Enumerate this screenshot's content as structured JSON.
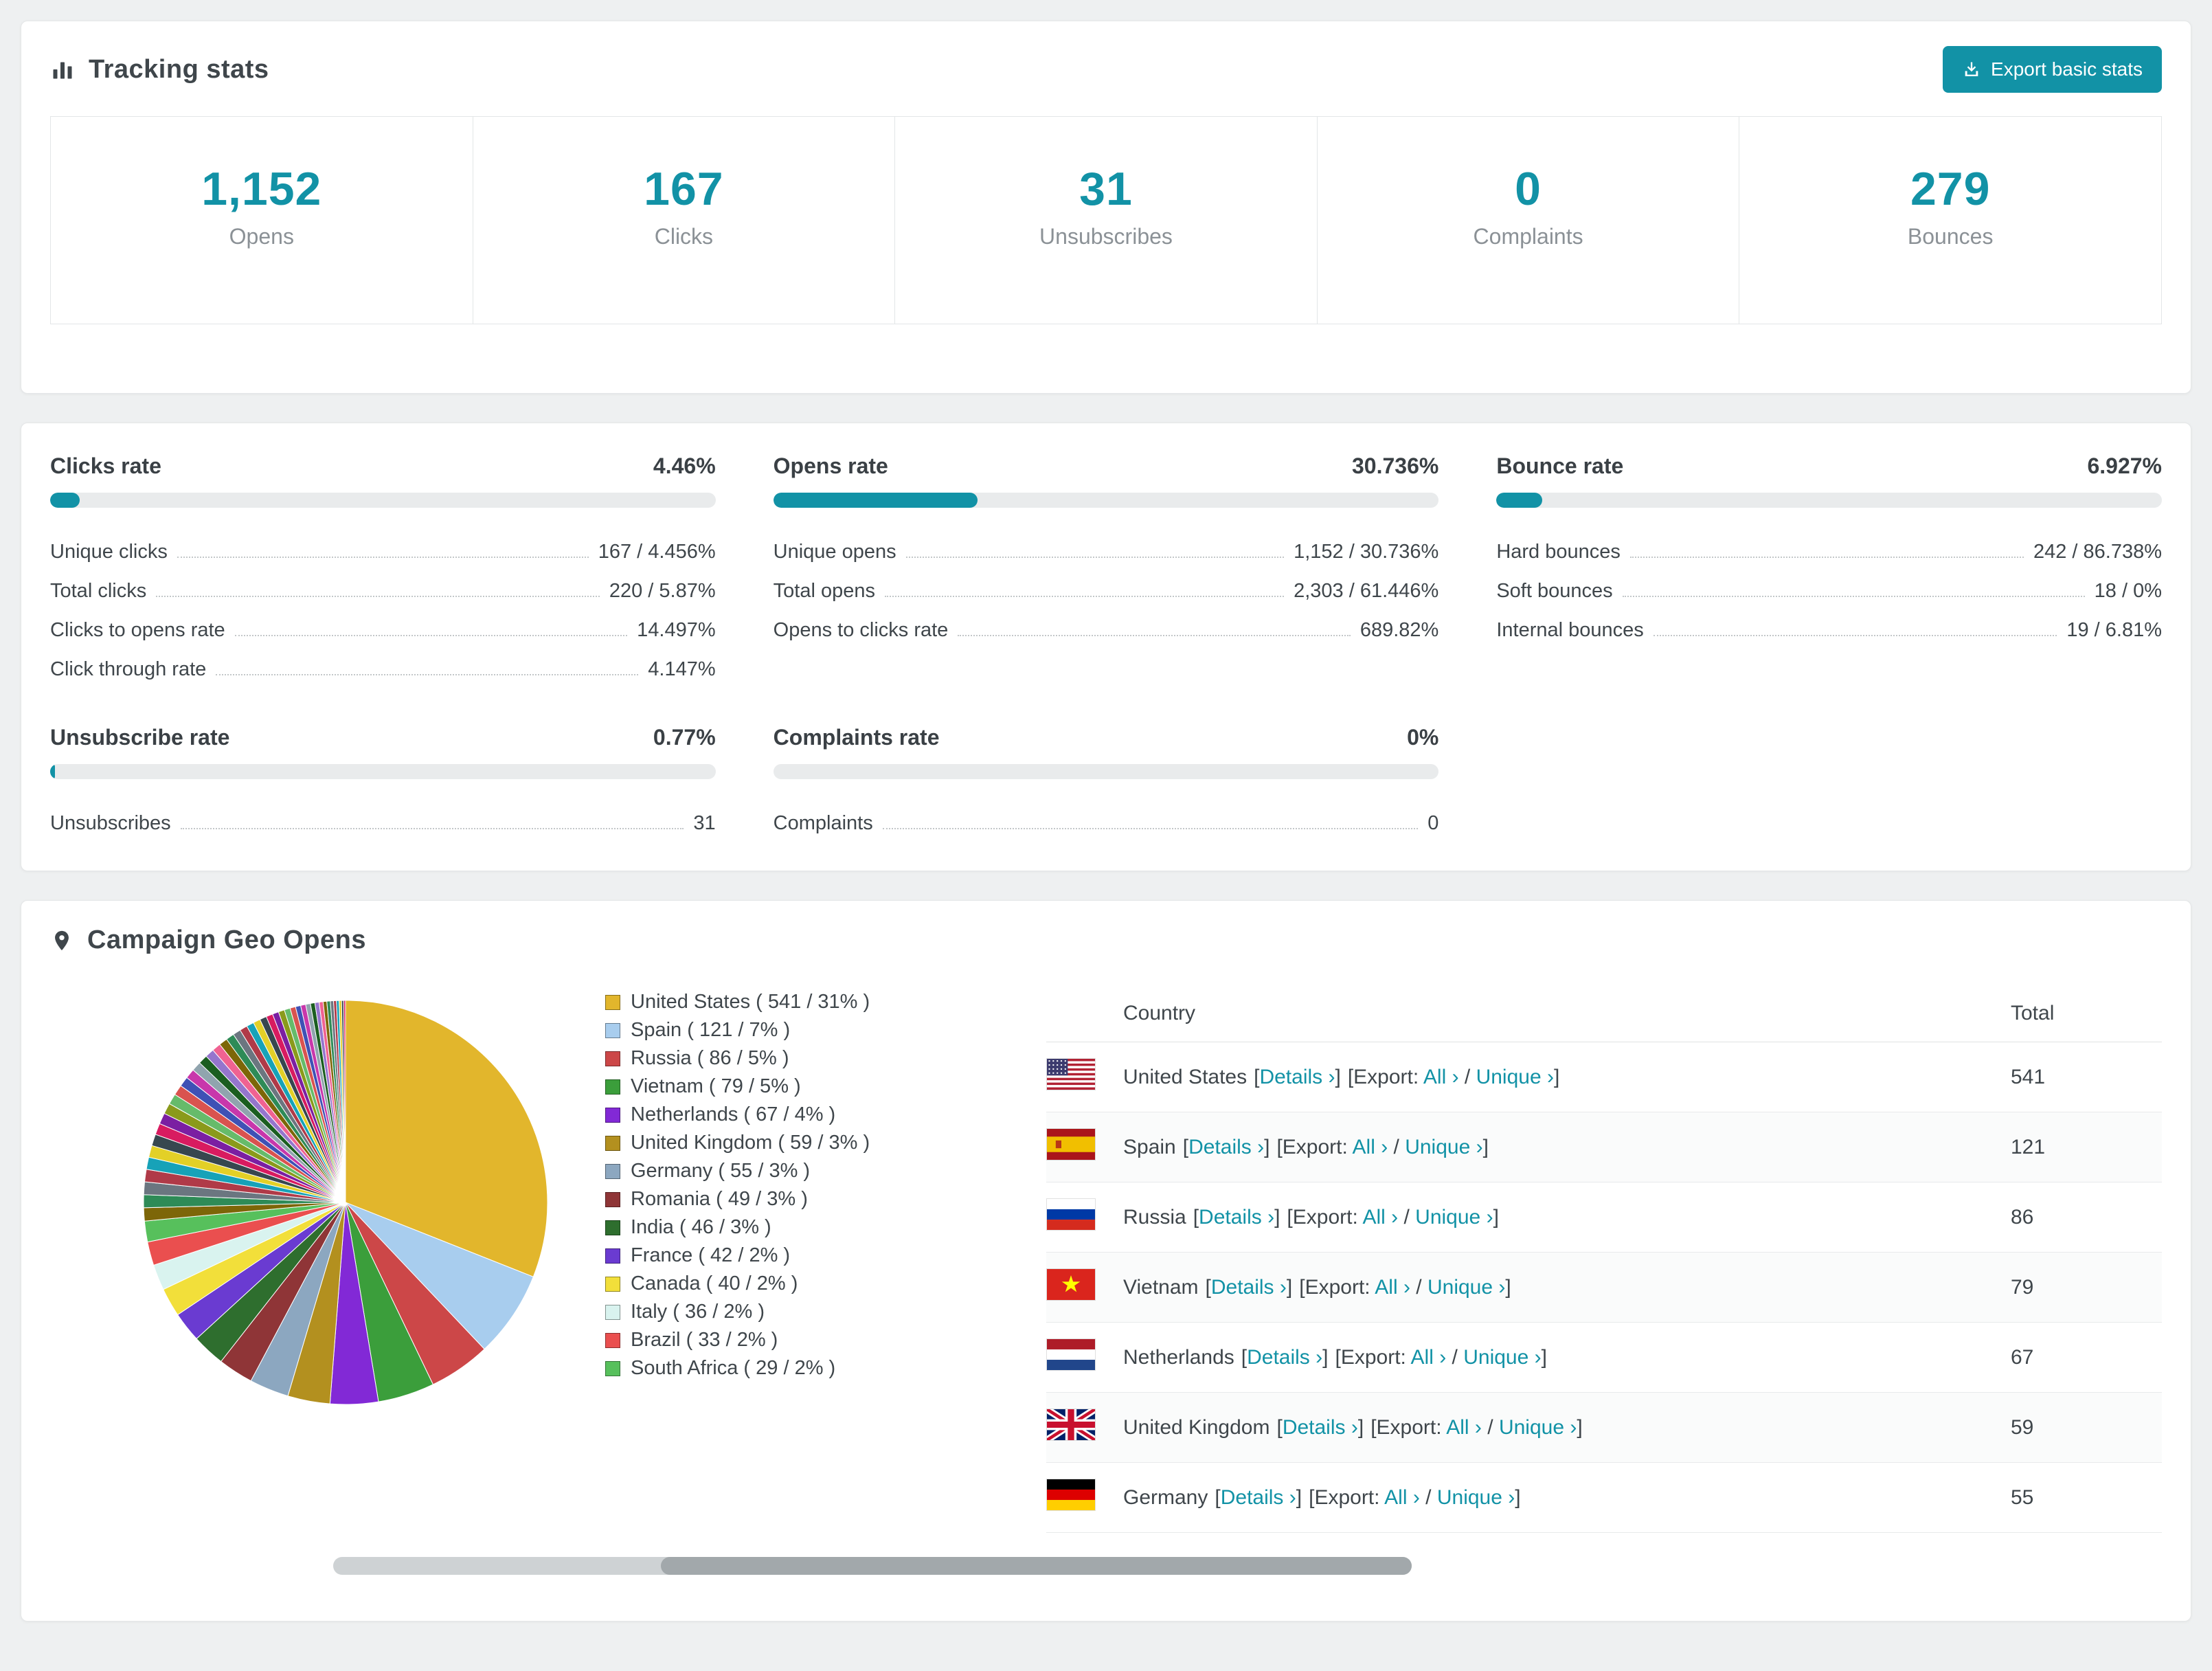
{
  "colors": {
    "accent": "#1292a6",
    "link": "#1292a6",
    "title_text": "#3f464b",
    "muted_text": "#8b9196"
  },
  "tracking": {
    "title": "Tracking stats",
    "export_label": "Export basic stats",
    "stats": [
      {
        "value": "1,152",
        "label": "Opens"
      },
      {
        "value": "167",
        "label": "Clicks"
      },
      {
        "value": "31",
        "label": "Unsubscribes"
      },
      {
        "value": "0",
        "label": "Complaints"
      },
      {
        "value": "279",
        "label": "Bounces"
      }
    ]
  },
  "rates": [
    {
      "title": "Clicks rate",
      "value": "4.46%",
      "percent": 4.46,
      "rows": [
        [
          "Unique clicks",
          "167 / 4.456%"
        ],
        [
          "Total clicks",
          "220 / 5.87%"
        ],
        [
          "Clicks to opens rate",
          "14.497%"
        ],
        [
          "Click through rate",
          "4.147%"
        ]
      ]
    },
    {
      "title": "Opens rate",
      "value": "30.736%",
      "percent": 30.736,
      "rows": [
        [
          "Unique opens",
          "1,152 / 30.736%"
        ],
        [
          "Total opens",
          "2,303 / 61.446%"
        ],
        [
          "Opens to clicks rate",
          "689.82%"
        ]
      ]
    },
    {
      "title": "Bounce rate",
      "value": "6.927%",
      "percent": 6.927,
      "rows": [
        [
          "Hard bounces",
          "242 / 86.738%"
        ],
        [
          "Soft bounces",
          "18 / 0%"
        ],
        [
          "Internal bounces",
          "19 / 6.81%"
        ]
      ]
    },
    {
      "title": "Unsubscribe rate",
      "value": "0.77%",
      "percent": 0.77,
      "rows": [
        [
          "Unsubscribes",
          "31"
        ]
      ]
    },
    {
      "title": "Complaints rate",
      "value": "0%",
      "percent": 0,
      "rows": [
        [
          "Complaints",
          "0"
        ]
      ]
    }
  ],
  "geo": {
    "title": "Campaign Geo Opens",
    "chart_data": {
      "type": "pie",
      "title": "Campaign Geo Opens",
      "legend_position": "right",
      "labels": [
        "United States",
        "Spain",
        "Russia",
        "Vietnam",
        "Netherlands",
        "United Kingdom",
        "Germany",
        "Romania",
        "India",
        "France",
        "Canada",
        "Italy",
        "Brazil",
        "South Africa"
      ],
      "values": [
        541,
        121,
        86,
        79,
        67,
        59,
        55,
        49,
        46,
        42,
        40,
        36,
        33,
        29
      ],
      "percents": [
        31,
        7,
        5,
        5,
        4,
        3,
        3,
        3,
        3,
        2,
        2,
        2,
        2,
        2
      ],
      "colors": [
        "#e2b62c",
        "#a8cdee",
        "#cc4748",
        "#3b9e3b",
        "#8229d6",
        "#b3901f",
        "#8ca7c0",
        "#8f3537",
        "#2e6e2e",
        "#6a3bd1",
        "#f2df3a",
        "#d9f3ef",
        "#ea4f4f",
        "#57c05c"
      ],
      "others": {
        "value": 462,
        "slices": 44,
        "palette": [
          "#7d6608",
          "#2e8b57",
          "#6b7680",
          "#b03a48",
          "#17a2b8",
          "#e3d027",
          "#37474f",
          "#d81b60",
          "#7b1fa2",
          "#8a9a1b",
          "#66bb6a",
          "#d9534f",
          "#3f51b5",
          "#c837ab",
          "#90a4ae",
          "#1b5e20",
          "#9575cd",
          "#f06292"
        ]
      }
    },
    "table": {
      "headers": [
        "Country",
        "Total"
      ],
      "details_label": "Details ›",
      "export_label": "Export:",
      "all_label": "All ›",
      "unique_label": "Unique ›",
      "rows": [
        {
          "country": "United States",
          "total": "541",
          "flag": "us"
        },
        {
          "country": "Spain",
          "total": "121",
          "flag": "es"
        },
        {
          "country": "Russia",
          "total": "86",
          "flag": "ru"
        },
        {
          "country": "Vietnam",
          "total": "79",
          "flag": "vn"
        },
        {
          "country": "Netherlands",
          "total": "67",
          "flag": "nl"
        },
        {
          "country": "United Kingdom",
          "total": "59",
          "flag": "gb"
        },
        {
          "country": "Germany",
          "total": "55",
          "flag": "de"
        }
      ]
    }
  }
}
